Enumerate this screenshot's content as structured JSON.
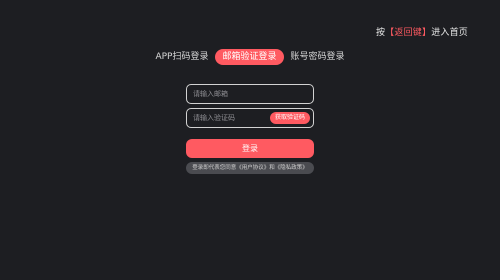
{
  "hint": {
    "prefix": "按",
    "key": "【返回键】",
    "suffix": "进入首页"
  },
  "tabs": [
    {
      "label": "APP扫码登录"
    },
    {
      "label": "邮箱验证登录"
    },
    {
      "label": "账号密码登录"
    }
  ],
  "active_tab": "邮箱验证登录",
  "form": {
    "email_placeholder": "请输入邮箱",
    "email_value": "",
    "code_placeholder": "请输入验证码",
    "code_value": "",
    "get_code_label": "获取验证码",
    "login_label": "登录"
  },
  "agreement": "登录即代表您同意《用户协议》和《隐私政策》",
  "colors": {
    "accent": "#ff5a61",
    "background": "#1d1e22"
  }
}
